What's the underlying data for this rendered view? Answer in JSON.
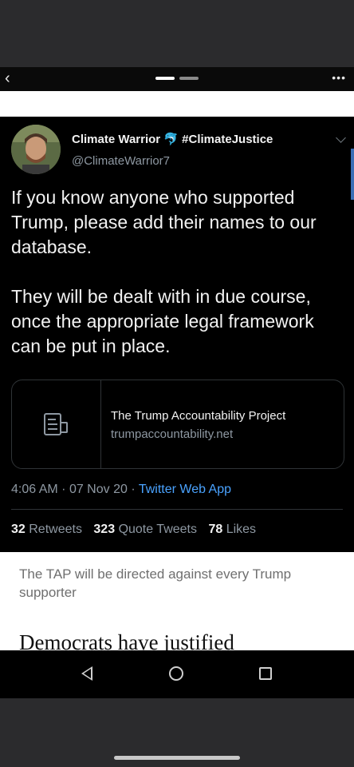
{
  "viewer": {
    "back_glyph": "‹",
    "more_glyph": "•••"
  },
  "tweet": {
    "display_name": "Climate Warrior",
    "badge_emoji": "🐬",
    "name_hashtag": "#ClimateJustice",
    "handle": "@ClimateWarrior7",
    "paragraph_1": "If you know anyone who supported Trump, please add their names to our database.",
    "paragraph_2": "They will be dealt with in due course, once the appropriate legal framework can be put in place.",
    "card": {
      "title": "The Trump Accountability Project",
      "url": "trumpaccountability.net",
      "icon": "document-icon"
    },
    "time": "4:06 AM",
    "date": "07 Nov 20",
    "source": "Twitter Web App",
    "separator": "·",
    "retweets_count": "32",
    "retweets_label": "Retweets",
    "quote_count": "323",
    "quote_label": "Quote Tweets",
    "likes_count": "78",
    "likes_label": "Likes"
  },
  "article": {
    "subtitle": "The TAP will be directed against every Trump supporter",
    "headline": "Democrats have justified"
  },
  "nav": {
    "back": "back-triangle-icon",
    "home": "home-circle-icon",
    "recent": "recent-square-icon"
  },
  "colors": {
    "accent": "#4aa3ff",
    "tweet_bg": "#000000",
    "muted": "#8e98a2"
  }
}
